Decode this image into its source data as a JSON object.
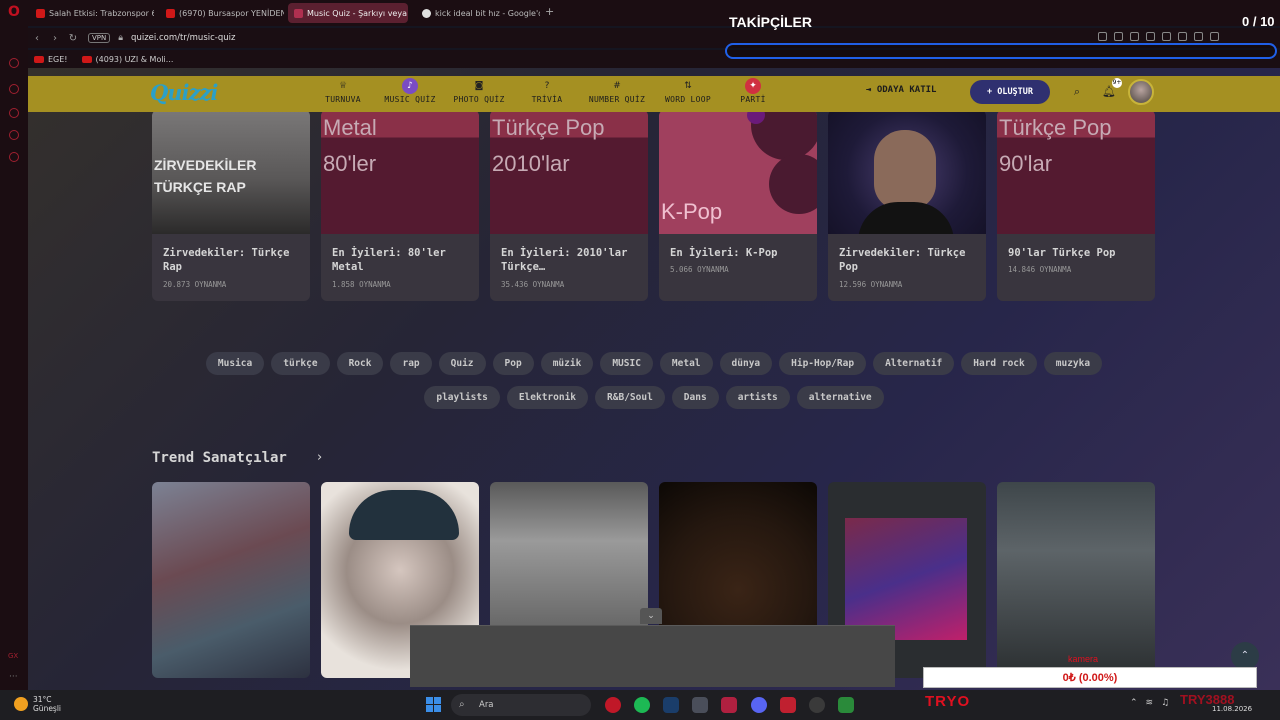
{
  "browser": {
    "tabs": [
      {
        "label": "Salah Etkisi: Trabzonspor 6",
        "favicon_color": "#d01818",
        "active": false
      },
      {
        "label": "(6970) Bursaspor YENİDEN",
        "favicon_color": "#d01818",
        "active": false
      },
      {
        "label": "Music Quiz - Şarkıyı veya",
        "favicon_color": "#b03050",
        "active": true
      },
      {
        "label": "kick ideal bit hız - Google'd",
        "favicon_color": "#e0e0e0",
        "active": false
      }
    ],
    "vpn_label": "VPN",
    "url": "quizei.com/tr/music-quiz",
    "bookmarks": [
      {
        "label": "EGE!"
      },
      {
        "label": "(4093) UZI & Moli..."
      }
    ]
  },
  "stream_overlay": {
    "followers_label": "TAKİPÇİLER",
    "followers_count": "0 / 10",
    "followers_progress": 0,
    "camera_label": "kamera",
    "money_text": "0₺ (0.00%)",
    "brand_text": "TRYO",
    "brand_text_2": "TRY3888"
  },
  "site": {
    "logo": "Quizzi",
    "nav": [
      {
        "label": "TURNUVA",
        "icon": "trophy-icon",
        "glyph": "♕"
      },
      {
        "label": "MUSIC QUİZ",
        "icon": "music-note-icon",
        "glyph": "♪",
        "highlight": "#7a4cc4"
      },
      {
        "label": "PHOTO QUİZ",
        "icon": "camera-icon",
        "glyph": "◙"
      },
      {
        "label": "TRİVİA",
        "icon": "question-icon",
        "glyph": "?"
      },
      {
        "label": "NUMBER QUİZ",
        "icon": "hash-icon",
        "glyph": "#"
      },
      {
        "label": "WORD LOOP",
        "icon": "sort-icon",
        "glyph": "⇅"
      },
      {
        "label": "PARTİ",
        "icon": "party-icon",
        "glyph": "✦",
        "highlight": "#d03040"
      }
    ],
    "join_label": "ODAYA KATIL",
    "create_label": "+ OLUŞTUR",
    "notification_badge": "9+"
  },
  "quiz_cards": [
    {
      "thumb_text": "ZİRVEDEKİLER\nTÜRKÇE RAP",
      "title": "Zirvedekiler: Türkçe Rap",
      "plays": "20.873 OYNANMA",
      "style": "rap"
    },
    {
      "thumb_text": "Metal\n80'ler",
      "title": "En İyileri: 80'ler Metal",
      "plays": "1.858 OYNANMA",
      "style": "plain"
    },
    {
      "thumb_text": "Türkçe Pop\n2010'lar",
      "title": "En İyileri: 2010'lar Türkçe…",
      "plays": "35.436 OYNANMA",
      "style": "plain"
    },
    {
      "thumb_text": "K-Pop",
      "title": "En İyileri: K-Pop",
      "plays": "5.066 OYNANMA",
      "style": "kpop",
      "short": true
    },
    {
      "thumb_text": "",
      "title": "Zirvedekiler: Türkçe Pop",
      "plays": "12.596 OYNANMA",
      "style": "portrait"
    },
    {
      "thumb_text": "Türkçe Pop\n90'lar",
      "title": "90'lar Türkçe Pop",
      "plays": "14.846 OYNANMA",
      "style": "plain",
      "short": true
    }
  ],
  "tags_row1": [
    "Musica",
    "türkçe",
    "Rock",
    "rap",
    "Quiz",
    "Pop",
    "müzik",
    "MUSIC",
    "Metal",
    "dünya",
    "Hip-Hop/Rap",
    "Alternatif",
    "Hard rock",
    "muzyka"
  ],
  "tags_row2": [
    "playlists",
    "Elektronik",
    "R&B/Soul",
    "Dans",
    "artists",
    "alternative"
  ],
  "trend_title": "Trend Sanatçılar",
  "taskbar": {
    "temperature": "31°C",
    "weather": "Güneşli",
    "search_placeholder": "Ara",
    "date": "11.08.2026"
  }
}
